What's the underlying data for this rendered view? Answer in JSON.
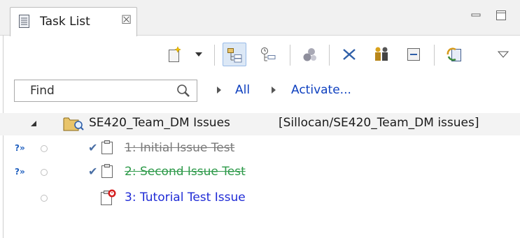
{
  "view": {
    "tab_title": "Task List",
    "tab_close_glyph": "☒",
    "icons": [
      "task-list-icon",
      "close-icon",
      "minimize-icon",
      "maximize-icon"
    ]
  },
  "toolbar": {
    "items": [
      "new-task-icon",
      "dropdown-icon",
      "categorized-icon",
      "scheduled-icon",
      "focus-icon",
      "collapse-all-icon",
      "synchronize-icon",
      "team-icon",
      "view-menu-icon"
    ],
    "pressed": "categorized-icon"
  },
  "filter": {
    "placeholder": "Find",
    "all_label": "All",
    "activate_label": "Activate..."
  },
  "tree": {
    "query": {
      "name": "SE420_Team_DM Issues",
      "repository": "[Sillocan/SE420_Team_DM issues]"
    },
    "tasks": [
      {
        "label": "1: Initial Issue Test",
        "incoming_marker": "?»",
        "status": "completed",
        "color": "#7a7a7a"
      },
      {
        "label": "2: Second Issue Test",
        "incoming_marker": "?»",
        "status": "completed",
        "color": "#2e9a4a"
      },
      {
        "label": "3: Tutorial Test Issue",
        "incoming_marker": "",
        "status": "scheduled",
        "color": "#1f2bd6"
      }
    ]
  },
  "colors": {
    "link": "#0d3fbf",
    "selection": "#f3f3f3"
  }
}
